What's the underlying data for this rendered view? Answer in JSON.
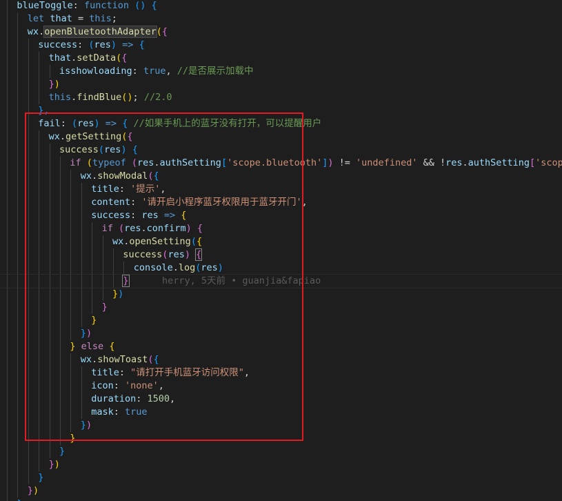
{
  "editor": {
    "colors": {
      "background": "#1e1e1e",
      "keyword": "#569cd6",
      "control": "#c586c0",
      "function": "#dcdcaa",
      "variable": "#9cdcfe",
      "string": "#ce9178",
      "comment": "#6a9955",
      "number": "#b5cea8",
      "bracket_1": "#ffd700",
      "bracket_2": "#da70d6",
      "bracket_3": "#179fff",
      "highlight_box": "#e31c23"
    },
    "lines": [
      {
        "indent": 1,
        "tokens": [
          {
            "t": "blueToggle",
            "c": "var"
          },
          {
            "t": ": ",
            "c": "punc"
          },
          {
            "t": "function",
            "c": "kw"
          },
          {
            "t": " ",
            "c": "punc"
          },
          {
            "t": "()",
            "c": "b3"
          },
          {
            "t": " ",
            "c": "punc"
          },
          {
            "t": "{",
            "c": "b3"
          }
        ]
      },
      {
        "indent": 2,
        "tokens": [
          {
            "t": "let",
            "c": "kw"
          },
          {
            "t": " ",
            "c": "punc"
          },
          {
            "t": "that",
            "c": "var"
          },
          {
            "t": " = ",
            "c": "punc"
          },
          {
            "t": "this",
            "c": "kw"
          },
          {
            "t": ";",
            "c": "punc"
          }
        ]
      },
      {
        "indent": 2,
        "tokens": [
          {
            "t": "wx",
            "c": "var"
          },
          {
            "t": ".",
            "c": "punc"
          },
          {
            "t": "openBluetoothAdapter",
            "c": "fn",
            "hl": true
          },
          {
            "t": "(",
            "c": "b1"
          },
          {
            "t": "{",
            "c": "b2"
          }
        ]
      },
      {
        "indent": 3,
        "tokens": [
          {
            "t": "success",
            "c": "var"
          },
          {
            "t": ": ",
            "c": "punc"
          },
          {
            "t": "(",
            "c": "b3"
          },
          {
            "t": "res",
            "c": "var"
          },
          {
            "t": ")",
            "c": "b3"
          },
          {
            "t": " ",
            "c": "punc"
          },
          {
            "t": "=>",
            "c": "kw"
          },
          {
            "t": " ",
            "c": "punc"
          },
          {
            "t": "{",
            "c": "b3"
          }
        ]
      },
      {
        "indent": 4,
        "tokens": [
          {
            "t": "that",
            "c": "var"
          },
          {
            "t": ".",
            "c": "punc"
          },
          {
            "t": "setData",
            "c": "fn"
          },
          {
            "t": "(",
            "c": "b1"
          },
          {
            "t": "{",
            "c": "b2"
          }
        ]
      },
      {
        "indent": 5,
        "tokens": [
          {
            "t": "isshowloading",
            "c": "var"
          },
          {
            "t": ": ",
            "c": "punc"
          },
          {
            "t": "true",
            "c": "kw"
          },
          {
            "t": ", ",
            "c": "punc"
          },
          {
            "t": "//是否展示加载中",
            "c": "com"
          }
        ]
      },
      {
        "indent": 4,
        "tokens": [
          {
            "t": "}",
            "c": "b2"
          },
          {
            "t": ")",
            "c": "b1"
          }
        ]
      },
      {
        "indent": 4,
        "tokens": [
          {
            "t": "this",
            "c": "kw"
          },
          {
            "t": ".",
            "c": "punc"
          },
          {
            "t": "findBlue",
            "c": "fn"
          },
          {
            "t": "()",
            "c": "b1"
          },
          {
            "t": "; ",
            "c": "punc"
          },
          {
            "t": "//2.0",
            "c": "com"
          }
        ]
      },
      {
        "indent": 3,
        "tokens": [
          {
            "t": "},",
            "c": "b3"
          }
        ]
      },
      {
        "indent": 3,
        "tokens": [
          {
            "t": "fail",
            "c": "var"
          },
          {
            "t": ": ",
            "c": "punc"
          },
          {
            "t": "(",
            "c": "b3"
          },
          {
            "t": "res",
            "c": "var"
          },
          {
            "t": ")",
            "c": "b3"
          },
          {
            "t": " ",
            "c": "punc"
          },
          {
            "t": "=>",
            "c": "kw"
          },
          {
            "t": " ",
            "c": "punc"
          },
          {
            "t": "{",
            "c": "b3"
          },
          {
            "t": " ",
            "c": "punc"
          },
          {
            "t": "//如果手机上的蓝牙没有打开，可以提醒用户",
            "c": "com"
          }
        ]
      },
      {
        "indent": 4,
        "tokens": [
          {
            "t": "wx",
            "c": "var"
          },
          {
            "t": ".",
            "c": "punc"
          },
          {
            "t": "getSetting",
            "c": "fn"
          },
          {
            "t": "(",
            "c": "b1"
          },
          {
            "t": "{",
            "c": "b2"
          }
        ]
      },
      {
        "indent": 5,
        "tokens": [
          {
            "t": "success",
            "c": "fn"
          },
          {
            "t": "(",
            "c": "b3"
          },
          {
            "t": "res",
            "c": "var"
          },
          {
            "t": ")",
            "c": "b3"
          },
          {
            "t": " ",
            "c": "punc"
          },
          {
            "t": "{",
            "c": "b3"
          }
        ]
      },
      {
        "indent": 6,
        "tokens": [
          {
            "t": "if",
            "c": "ctrl"
          },
          {
            "t": " ",
            "c": "punc"
          },
          {
            "t": "(",
            "c": "b1"
          },
          {
            "t": "typeof",
            "c": "kw"
          },
          {
            "t": " ",
            "c": "punc"
          },
          {
            "t": "(",
            "c": "b2"
          },
          {
            "t": "res",
            "c": "var"
          },
          {
            "t": ".",
            "c": "punc"
          },
          {
            "t": "authSetting",
            "c": "var"
          },
          {
            "t": "[",
            "c": "b3"
          },
          {
            "t": "'scope.bluetooth'",
            "c": "str"
          },
          {
            "t": "]",
            "c": "b3"
          },
          {
            "t": ")",
            "c": "b2"
          },
          {
            "t": " != ",
            "c": "punc"
          },
          {
            "t": "'undefined'",
            "c": "str"
          },
          {
            "t": " && !",
            "c": "punc"
          },
          {
            "t": "res",
            "c": "var"
          },
          {
            "t": ".",
            "c": "punc"
          },
          {
            "t": "authSetting",
            "c": "var"
          },
          {
            "t": "[",
            "c": "b2"
          },
          {
            "t": "'scope.blu",
            "c": "str"
          }
        ]
      },
      {
        "indent": 7,
        "tokens": [
          {
            "t": "wx",
            "c": "var"
          },
          {
            "t": ".",
            "c": "punc"
          },
          {
            "t": "showModal",
            "c": "fn"
          },
          {
            "t": "(",
            "c": "b2"
          },
          {
            "t": "{",
            "c": "b3"
          }
        ]
      },
      {
        "indent": 8,
        "tokens": [
          {
            "t": "title",
            "c": "var"
          },
          {
            "t": ": ",
            "c": "punc"
          },
          {
            "t": "'提示'",
            "c": "str"
          },
          {
            "t": ",",
            "c": "punc"
          }
        ]
      },
      {
        "indent": 8,
        "tokens": [
          {
            "t": "content",
            "c": "var"
          },
          {
            "t": ": ",
            "c": "punc"
          },
          {
            "t": "'请开启小程序蓝牙权限用于蓝牙开门'",
            "c": "str"
          },
          {
            "t": ",",
            "c": "punc"
          }
        ]
      },
      {
        "indent": 8,
        "tokens": [
          {
            "t": "success",
            "c": "var"
          },
          {
            "t": ": ",
            "c": "punc"
          },
          {
            "t": "res",
            "c": "var"
          },
          {
            "t": " ",
            "c": "punc"
          },
          {
            "t": "=>",
            "c": "kw"
          },
          {
            "t": " ",
            "c": "punc"
          },
          {
            "t": "{",
            "c": "b1"
          }
        ]
      },
      {
        "indent": 9,
        "tokens": [
          {
            "t": "if",
            "c": "ctrl"
          },
          {
            "t": " ",
            "c": "punc"
          },
          {
            "t": "(",
            "c": "b2"
          },
          {
            "t": "res",
            "c": "var"
          },
          {
            "t": ".",
            "c": "punc"
          },
          {
            "t": "confirm",
            "c": "var"
          },
          {
            "t": ")",
            "c": "b2"
          },
          {
            "t": " ",
            "c": "punc"
          },
          {
            "t": "{",
            "c": "b2"
          }
        ]
      },
      {
        "indent": 10,
        "tokens": [
          {
            "t": "wx",
            "c": "var"
          },
          {
            "t": ".",
            "c": "punc"
          },
          {
            "t": "openSetting",
            "c": "fn"
          },
          {
            "t": "(",
            "c": "b3"
          },
          {
            "t": "{",
            "c": "b1"
          }
        ]
      },
      {
        "indent": 11,
        "tokens": [
          {
            "t": "success",
            "c": "fn"
          },
          {
            "t": "(",
            "c": "b2"
          },
          {
            "t": "res",
            "c": "var"
          },
          {
            "t": ")",
            "c": "b2"
          },
          {
            "t": " ",
            "c": "punc"
          },
          {
            "t": "{",
            "c": "b2",
            "match": true
          }
        ]
      },
      {
        "indent": 12,
        "tokens": [
          {
            "t": "console",
            "c": "var"
          },
          {
            "t": ".",
            "c": "punc"
          },
          {
            "t": "log",
            "c": "fn"
          },
          {
            "t": "(",
            "c": "b3"
          },
          {
            "t": "res",
            "c": "var"
          },
          {
            "t": ")",
            "c": "b3"
          }
        ]
      },
      {
        "indent": 11,
        "tokens": [
          {
            "t": "}",
            "c": "b2",
            "match": true
          }
        ],
        "blame": "herry, 5天前 • guanjia&fapiao"
      },
      {
        "indent": 10,
        "tokens": [
          {
            "t": "}",
            "c": "b1"
          },
          {
            "t": ")",
            "c": "b3"
          }
        ]
      },
      {
        "indent": 9,
        "tokens": [
          {
            "t": "}",
            "c": "b2"
          }
        ]
      },
      {
        "indent": 8,
        "tokens": [
          {
            "t": "}",
            "c": "b1"
          }
        ]
      },
      {
        "indent": 7,
        "tokens": [
          {
            "t": "}",
            "c": "b3"
          },
          {
            "t": ")",
            "c": "b2"
          }
        ]
      },
      {
        "indent": 6,
        "tokens": [
          {
            "t": "}",
            "c": "b1"
          },
          {
            "t": " ",
            "c": "punc"
          },
          {
            "t": "else",
            "c": "ctrl"
          },
          {
            "t": " ",
            "c": "punc"
          },
          {
            "t": "{",
            "c": "b1"
          }
        ]
      },
      {
        "indent": 7,
        "tokens": [
          {
            "t": "wx",
            "c": "var"
          },
          {
            "t": ".",
            "c": "punc"
          },
          {
            "t": "showToast",
            "c": "fn"
          },
          {
            "t": "(",
            "c": "b2"
          },
          {
            "t": "{",
            "c": "b3"
          }
        ]
      },
      {
        "indent": 8,
        "tokens": [
          {
            "t": "title",
            "c": "var"
          },
          {
            "t": ": ",
            "c": "punc"
          },
          {
            "t": "\"请打开手机蓝牙访问权限\"",
            "c": "str"
          },
          {
            "t": ",",
            "c": "punc"
          }
        ]
      },
      {
        "indent": 8,
        "tokens": [
          {
            "t": "icon",
            "c": "var"
          },
          {
            "t": ": ",
            "c": "punc"
          },
          {
            "t": "'none'",
            "c": "str"
          },
          {
            "t": ",",
            "c": "punc"
          }
        ]
      },
      {
        "indent": 8,
        "tokens": [
          {
            "t": "duration",
            "c": "var"
          },
          {
            "t": ": ",
            "c": "punc"
          },
          {
            "t": "1500",
            "c": "num"
          },
          {
            "t": ",",
            "c": "punc"
          }
        ]
      },
      {
        "indent": 8,
        "tokens": [
          {
            "t": "mask",
            "c": "var"
          },
          {
            "t": ": ",
            "c": "punc"
          },
          {
            "t": "true",
            "c": "kw"
          }
        ]
      },
      {
        "indent": 7,
        "tokens": [
          {
            "t": "}",
            "c": "b3"
          },
          {
            "t": ")",
            "c": "b2"
          }
        ]
      },
      {
        "indent": 6,
        "tokens": [
          {
            "t": "}",
            "c": "b1"
          }
        ]
      },
      {
        "indent": 5,
        "tokens": [
          {
            "t": "}",
            "c": "b3"
          }
        ]
      },
      {
        "indent": 4,
        "tokens": [
          {
            "t": "}",
            "c": "b2"
          },
          {
            "t": ")",
            "c": "b1"
          }
        ]
      },
      {
        "indent": 3,
        "tokens": [
          {
            "t": "}",
            "c": "b3"
          }
        ]
      },
      {
        "indent": 2,
        "tokens": [
          {
            "t": "}",
            "c": "b2"
          },
          {
            "t": ")",
            "c": "b1"
          }
        ]
      },
      {
        "indent": 1,
        "tokens": [
          {
            "t": "}",
            "c": "b3"
          }
        ]
      }
    ]
  }
}
